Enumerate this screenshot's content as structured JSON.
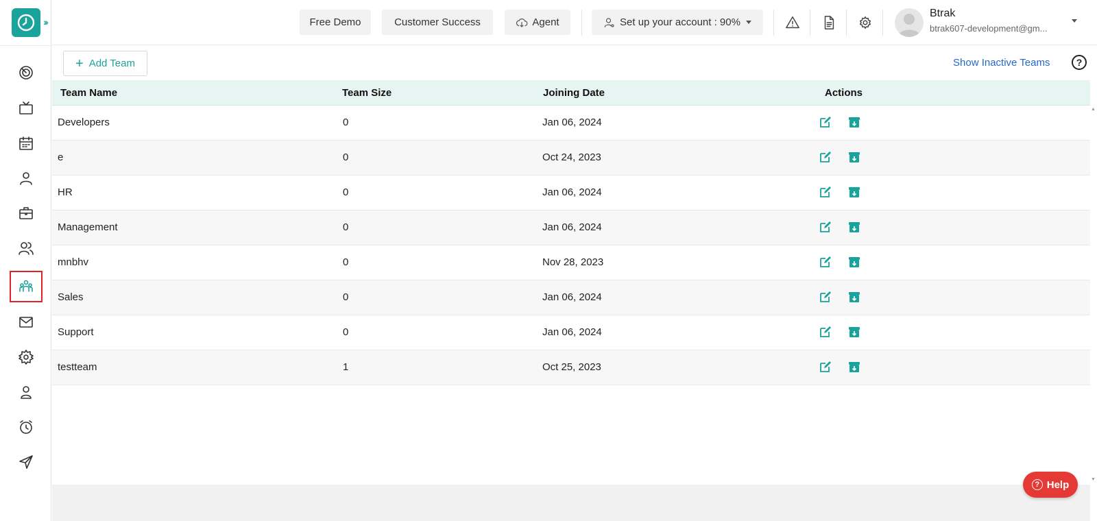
{
  "header": {
    "free_demo": "Free Demo",
    "customer_success": "Customer Success",
    "agent": "Agent",
    "setup_account": "Set up your account : 90%",
    "user": {
      "name": "Btrak",
      "email": "btrak607-development@gm..."
    }
  },
  "toolbar": {
    "add_team": "Add Team",
    "show_inactive": "Show Inactive Teams",
    "help_mark": "?"
  },
  "table": {
    "columns": [
      "Team Name",
      "Team Size",
      "Joining Date",
      "Actions"
    ],
    "rows": [
      {
        "name": "Developers",
        "size": "0",
        "date": "Jan 06, 2024"
      },
      {
        "name": "e",
        "size": "0",
        "date": "Oct 24, 2023"
      },
      {
        "name": "HR",
        "size": "0",
        "date": "Jan 06, 2024"
      },
      {
        "name": "Management",
        "size": "0",
        "date": "Jan 06, 2024"
      },
      {
        "name": "mnbhv",
        "size": "0",
        "date": "Nov 28, 2023"
      },
      {
        "name": "Sales",
        "size": "0",
        "date": "Jan 06, 2024"
      },
      {
        "name": "Support",
        "size": "0",
        "date": "Jan 06, 2024"
      },
      {
        "name": "testteam",
        "size": "1",
        "date": "Oct 25, 2023"
      }
    ]
  },
  "help_button": "Help",
  "sidebar": {
    "items": [
      "dashboard-icon",
      "tv-icon",
      "calendar-icon",
      "user-icon",
      "briefcase-icon",
      "users-icon",
      "teams-icon",
      "mail-icon",
      "settings-icon",
      "profile-icon",
      "alarm-icon",
      "send-icon"
    ],
    "active": "teams-icon"
  },
  "colors": {
    "accent": "#1aa39a",
    "highlight": "#e02424",
    "link": "#2667c9",
    "help": "#e53935"
  }
}
